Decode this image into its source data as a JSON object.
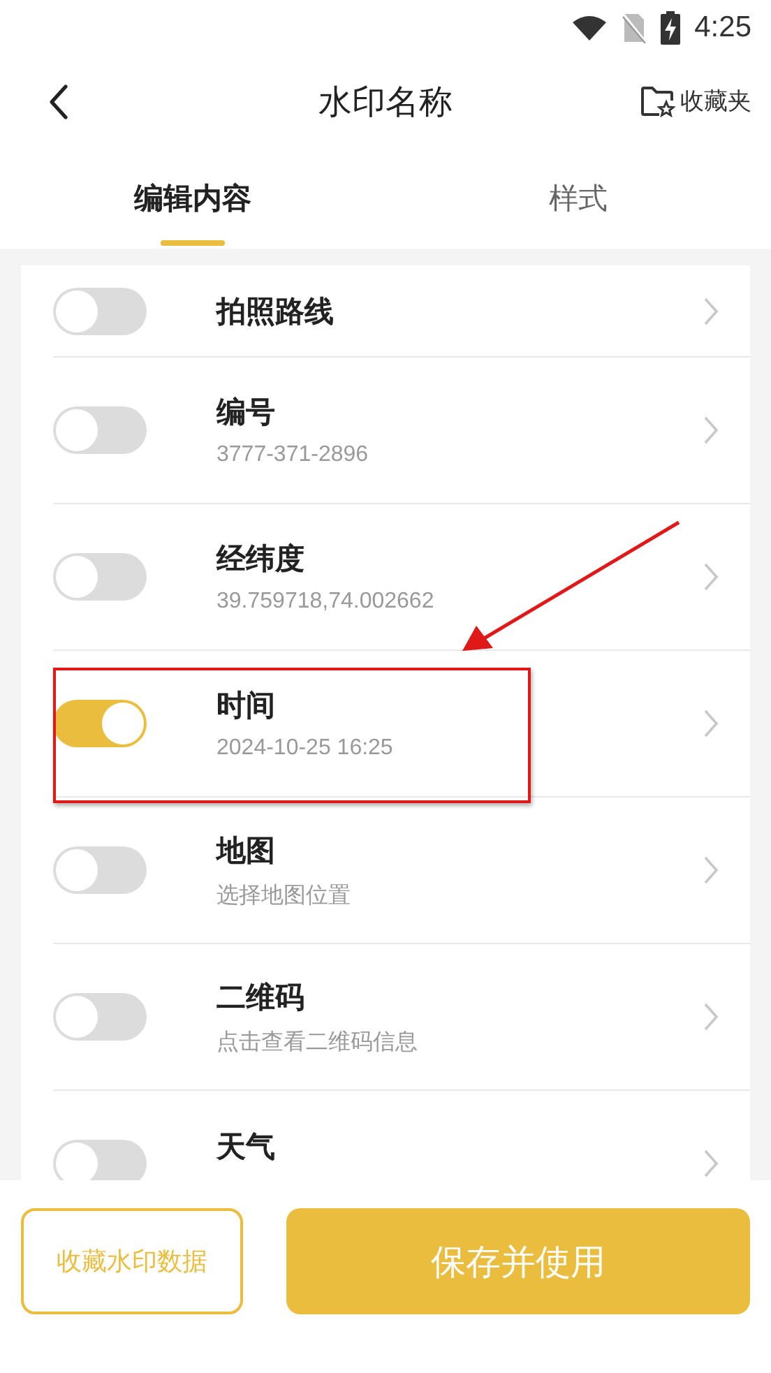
{
  "status_bar": {
    "time": "4:25"
  },
  "header": {
    "title": "水印名称",
    "favorites_label": "收藏夹"
  },
  "tabs": [
    {
      "label": "编辑内容",
      "selected": true
    },
    {
      "label": "样式",
      "selected": false
    }
  ],
  "items": [
    {
      "title": "拍照路线",
      "on": false,
      "highlighted": false
    },
    {
      "title": "编号",
      "subtitle": "3777-371-2896",
      "on": false,
      "highlighted": false
    },
    {
      "title": "经纬度",
      "subtitle": "39.759718,74.002662",
      "on": false,
      "highlighted": false
    },
    {
      "title": "时间",
      "subtitle": "2024-10-25 16:25",
      "on": true,
      "highlighted": true
    },
    {
      "title": "地图",
      "subtitle": "选择地图位置",
      "on": false,
      "highlighted": false
    },
    {
      "title": "二维码",
      "subtitle": "点击查看二维码信息",
      "on": false,
      "highlighted": false
    },
    {
      "title": "天气",
      "on": false,
      "highlighted": false
    }
  ],
  "buttons": {
    "save_data": "收藏水印数据",
    "save_use": "保存并使用"
  }
}
